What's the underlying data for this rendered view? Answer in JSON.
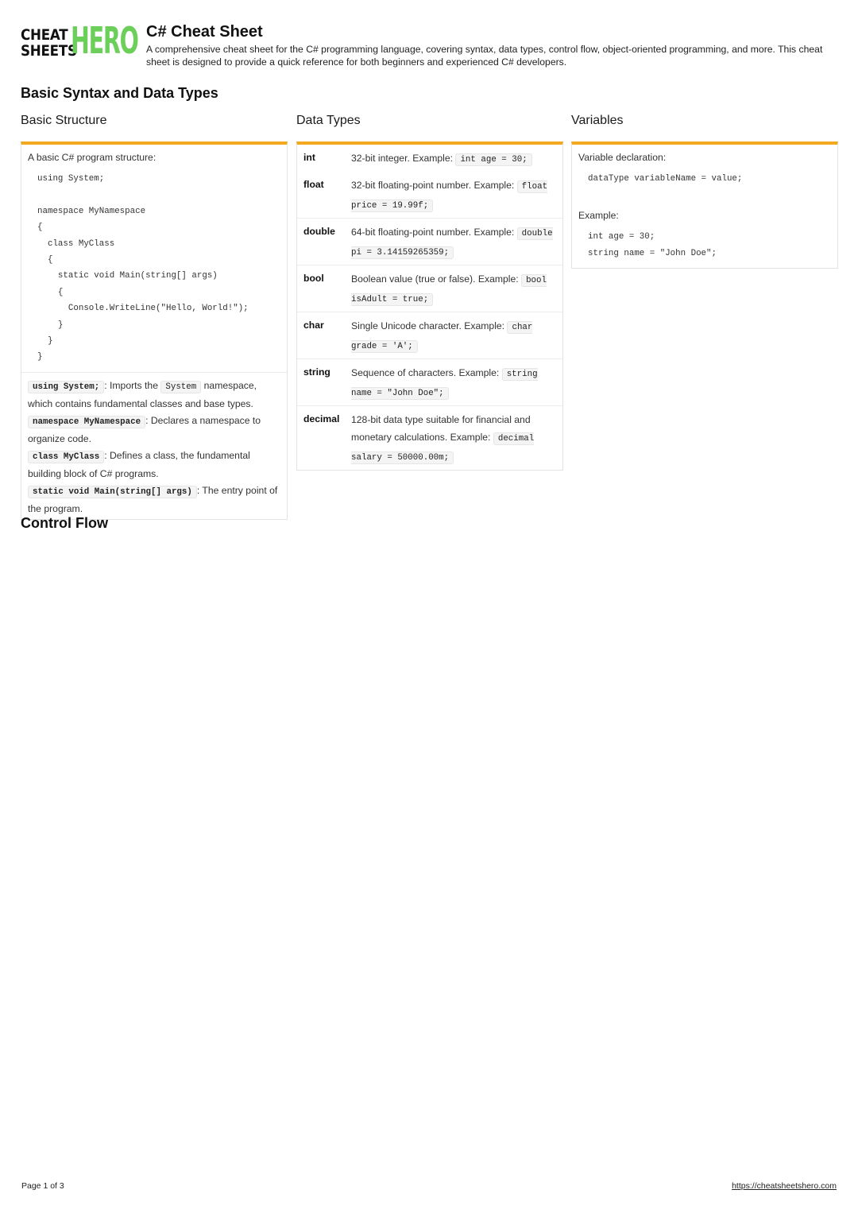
{
  "header": {
    "logo": {
      "line1": "CHEAT",
      "line2": "SHEETS",
      "hero": "HERO",
      "hero_color": "#6ccf5a"
    },
    "title": "C# Cheat Sheet",
    "description": "A comprehensive cheat sheet for the C# programming language, covering syntax, data types, control flow, object-oriented programming, and more. This cheat sheet is designed to provide a quick reference for both beginners and experienced C# developers."
  },
  "accent_color": "#f2a91f",
  "sections": [
    {
      "title": "Basic Syntax and Data Types"
    },
    {
      "title": "Control Flow"
    }
  ],
  "basic_structure": {
    "title": "Basic Structure",
    "intro": "A basic C# program structure:",
    "code": [
      "using System;",
      "",
      "namespace MyNamespace",
      "{",
      "  class MyClass",
      "  {",
      "    static void Main(string[] args)",
      "    {",
      "      Console.WriteLine(\"Hello, World!\");",
      "    }",
      "  }",
      "}"
    ],
    "notes": [
      {
        "code": "using System;",
        "text_before_code2": ": Imports the ",
        "code2": "System",
        "text": " namespace, which contains fundamental classes and base types."
      },
      {
        "code": "namespace MyNamespace",
        "text": ": Declares a namespace to organize code."
      },
      {
        "code": "class MyClass",
        "text": ": Defines a class, the fundamental building block of C# programs."
      },
      {
        "code": "static void Main(string[] args)",
        "text": ": The entry point of the program."
      }
    ]
  },
  "data_types": {
    "title": "Data Types",
    "rows": [
      {
        "name": "int",
        "desc": "32-bit integer. Example: ",
        "example": "int age = 30;"
      },
      {
        "name": "float",
        "desc": "32-bit floating-point number. Example: ",
        "example": "float price = 19.99f;"
      },
      {
        "name": "double",
        "desc": "64-bit floating-point number. Example: ",
        "example": "double pi = 3.14159265359;"
      },
      {
        "name": "bool",
        "desc": "Boolean value (true or false). Example: ",
        "example": "bool isAdult = true;"
      },
      {
        "name": "char",
        "desc": "Single Unicode character. Example: ",
        "example": "char grade = 'A';"
      },
      {
        "name": "string",
        "desc": "Sequence of characters. Example: ",
        "example": "string name = \"John Doe\";"
      },
      {
        "name": "decimal",
        "desc": "128-bit data type suitable for financial and monetary calculations. Example: ",
        "example": "decimal salary = 50000.00m;"
      }
    ]
  },
  "variables": {
    "title": "Variables",
    "declaration_label": "Variable declaration:",
    "declaration_code": "dataType variableName = value;",
    "example_label": "Example:",
    "example_code": [
      "int age = 30;",
      "string name = \"John Doe\";"
    ]
  },
  "footer": {
    "page": "Page 1 of 3",
    "link": "https://cheatsheetshero.com"
  }
}
